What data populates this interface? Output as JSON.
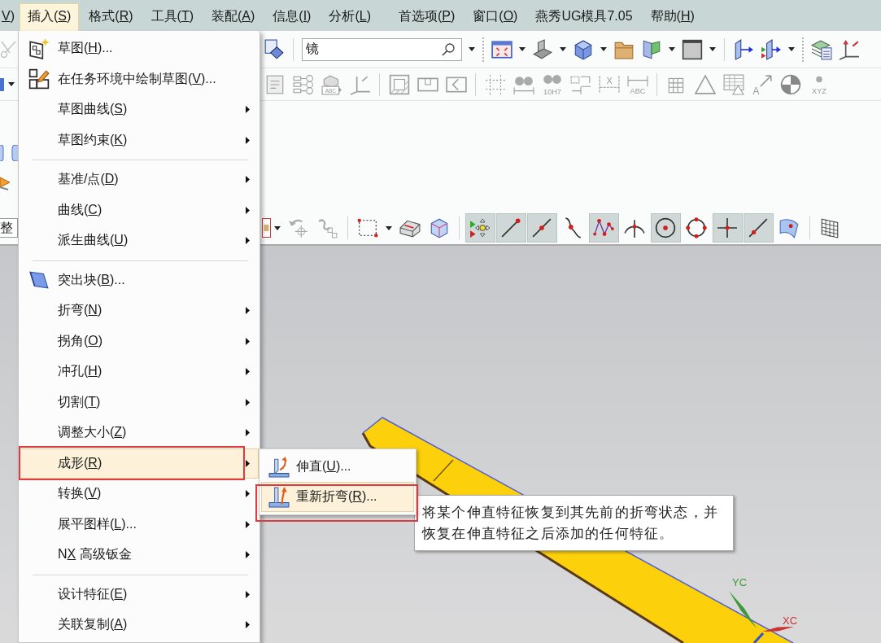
{
  "menu_bar": [
    {
      "access_key": "V",
      "text_after": ")",
      "selected": false
    },
    {
      "text_before": "插入(",
      "access_key": "S",
      "text_after": ")",
      "selected": true
    },
    {
      "text_before": "格式(",
      "access_key": "R",
      "text_after": ")",
      "selected": false
    },
    {
      "text_before": "工具(",
      "access_key": "T",
      "text_after": ")",
      "selected": false
    },
    {
      "text_before": "装配(",
      "access_key": "A",
      "text_after": ")",
      "selected": false
    },
    {
      "text_before": "信息(",
      "access_key": "I",
      "text_after": ")",
      "selected": false
    },
    {
      "text_before": "分析(",
      "access_key": "L",
      "text_after": ")",
      "selected": false
    },
    {
      "text_before": "首选项(",
      "access_key": "P",
      "text_after": ")",
      "selected": false
    },
    {
      "text_before": "窗口(",
      "access_key": "O",
      "text_after": ")",
      "selected": false
    },
    {
      "text_before": "燕秀UG模具7.05",
      "selected": false
    },
    {
      "text_before": "帮助(",
      "access_key": "H",
      "text_after": ")",
      "selected": false
    }
  ],
  "toolbar": {
    "search_field": {
      "value": "镜"
    },
    "icon_captions": [
      "ABC",
      "10H7",
      "X",
      "ABC",
      "A",
      "XYZ"
    ]
  },
  "clipped_field": {
    "value": "整"
  },
  "snap_toolbar": {
    "buttons": [
      {
        "on": true
      },
      {
        "on": true
      },
      {
        "on": true
      },
      {
        "on": false
      },
      {
        "on": true
      },
      {
        "on": false
      },
      {
        "on": true
      },
      {
        "on": false
      },
      {
        "on": true
      },
      {
        "on": true
      },
      {
        "on": false
      }
    ]
  },
  "insert_menu": {
    "groups": [
      {
        "items": [
          {
            "text_before": "草图(",
            "access_key": "H",
            "text_after": ")...",
            "submenu": false,
            "selected": false,
            "outlined": false
          },
          {
            "text_before": "在任务环境中绘制草图(",
            "access_key": "V",
            "text_after": ")...",
            "submenu": false,
            "selected": false,
            "outlined": false
          },
          {
            "text_before": "草图曲线(",
            "access_key": "S",
            "text_after": ")",
            "submenu": true,
            "selected": false,
            "outlined": false
          },
          {
            "text_before": "草图约束(",
            "access_key": "K",
            "text_after": ")",
            "submenu": true,
            "selected": false,
            "outlined": false
          }
        ]
      },
      {
        "items": [
          {
            "text_before": "基准/点(",
            "access_key": "D",
            "text_after": ")",
            "submenu": true,
            "selected": false,
            "outlined": false
          },
          {
            "text_before": "曲线(",
            "access_key": "C",
            "text_after": ")",
            "submenu": true,
            "selected": false,
            "outlined": false
          },
          {
            "text_before": "派生曲线(",
            "access_key": "U",
            "text_after": ")",
            "submenu": true,
            "selected": false,
            "outlined": false
          }
        ]
      },
      {
        "items": [
          {
            "text_before": "突出块(",
            "access_key": "B",
            "text_after": ")...",
            "submenu": false,
            "selected": false,
            "outlined": false
          },
          {
            "text_before": "折弯(",
            "access_key": "N",
            "text_after": ")",
            "submenu": true,
            "selected": false,
            "outlined": false
          },
          {
            "text_before": "拐角(",
            "access_key": "O",
            "text_after": ")",
            "submenu": true,
            "selected": false,
            "outlined": false
          },
          {
            "text_before": "冲孔(",
            "access_key": "H",
            "text_after": ")",
            "submenu": true,
            "selected": false,
            "outlined": false
          },
          {
            "text_before": "切割(",
            "access_key": "T",
            "text_after": ")",
            "submenu": true,
            "selected": false,
            "outlined": false
          },
          {
            "text_before": "调整大小(",
            "access_key": "Z",
            "text_after": ")",
            "submenu": true,
            "selected": false,
            "outlined": false
          },
          {
            "text_before": "成形(",
            "access_key": "R",
            "text_after": ")",
            "submenu": true,
            "selected": true,
            "outlined": true
          },
          {
            "text_before": "转换(",
            "access_key": "V",
            "text_after": ")",
            "submenu": true,
            "selected": false,
            "outlined": false
          },
          {
            "text_before": "展平图样(",
            "access_key": "L",
            "text_after": ")...",
            "submenu": true,
            "selected": false,
            "outlined": false
          },
          {
            "text_before": "N",
            "access_key": "X",
            "text_after": " 高级钣金",
            "submenu": true,
            "selected": false,
            "outlined": false
          }
        ]
      },
      {
        "items": [
          {
            "text_before": "设计特征(",
            "access_key": "E",
            "text_after": ")",
            "submenu": true,
            "selected": false,
            "outlined": false
          },
          {
            "text_before": "关联复制(",
            "access_key": "A",
            "text_after": ")",
            "submenu": true,
            "selected": false,
            "outlined": false
          }
        ]
      }
    ]
  },
  "forming_submenu": {
    "items": [
      {
        "text_before": "伸直(",
        "access_key": "U",
        "text_after": ")...",
        "selected": false,
        "outlined": false
      },
      {
        "text_before": "重新折弯(",
        "access_key": "R",
        "text_after": ")...",
        "selected": true,
        "outlined": true
      }
    ]
  },
  "tooltip": {
    "text": "将某个伸直特征恢复到其先前的折弯状态，并恢复在伸直特征之后添加的任何特征。"
  },
  "viewport": {
    "triad_axes": [
      {
        "label": "YC",
        "color": "#3c9a3c"
      },
      {
        "label": "XC",
        "color": "#cc3333"
      }
    ]
  }
}
